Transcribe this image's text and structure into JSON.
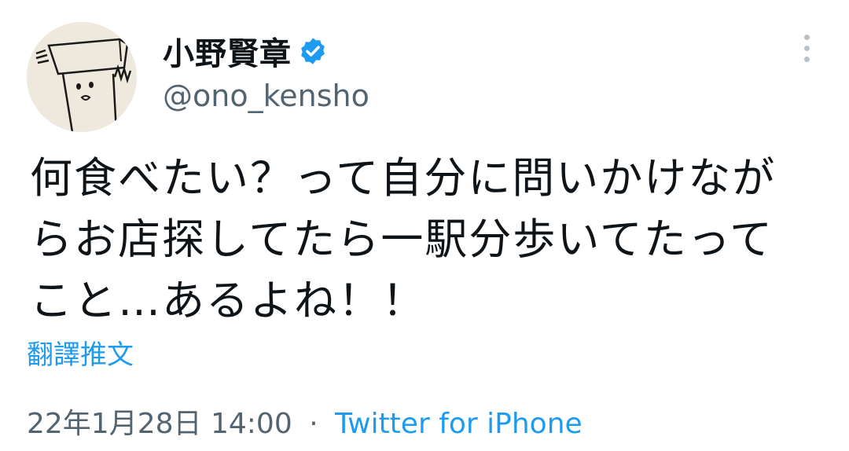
{
  "author": {
    "display_name": "小野賢章",
    "handle": "@ono_kensho",
    "verified": true,
    "avatar_icon": "caricature-avatar-icon"
  },
  "tweet": {
    "text": "何食べたい？って自分に問いかけなが\nらお店探してたら一駅分歩いてたって\nこと…あるよね！！",
    "translate_label": "翻譯推文",
    "date": "22年1月28日",
    "time": "14:00",
    "separator": "·",
    "source": "Twitter for iPhone"
  },
  "colors": {
    "accent": "#1d9bf0",
    "text": "#0f1419",
    "secondary": "#536471",
    "background": "#ffffff"
  },
  "icons": {
    "verified": "verified-badge-icon",
    "more": "more-options-icon"
  }
}
